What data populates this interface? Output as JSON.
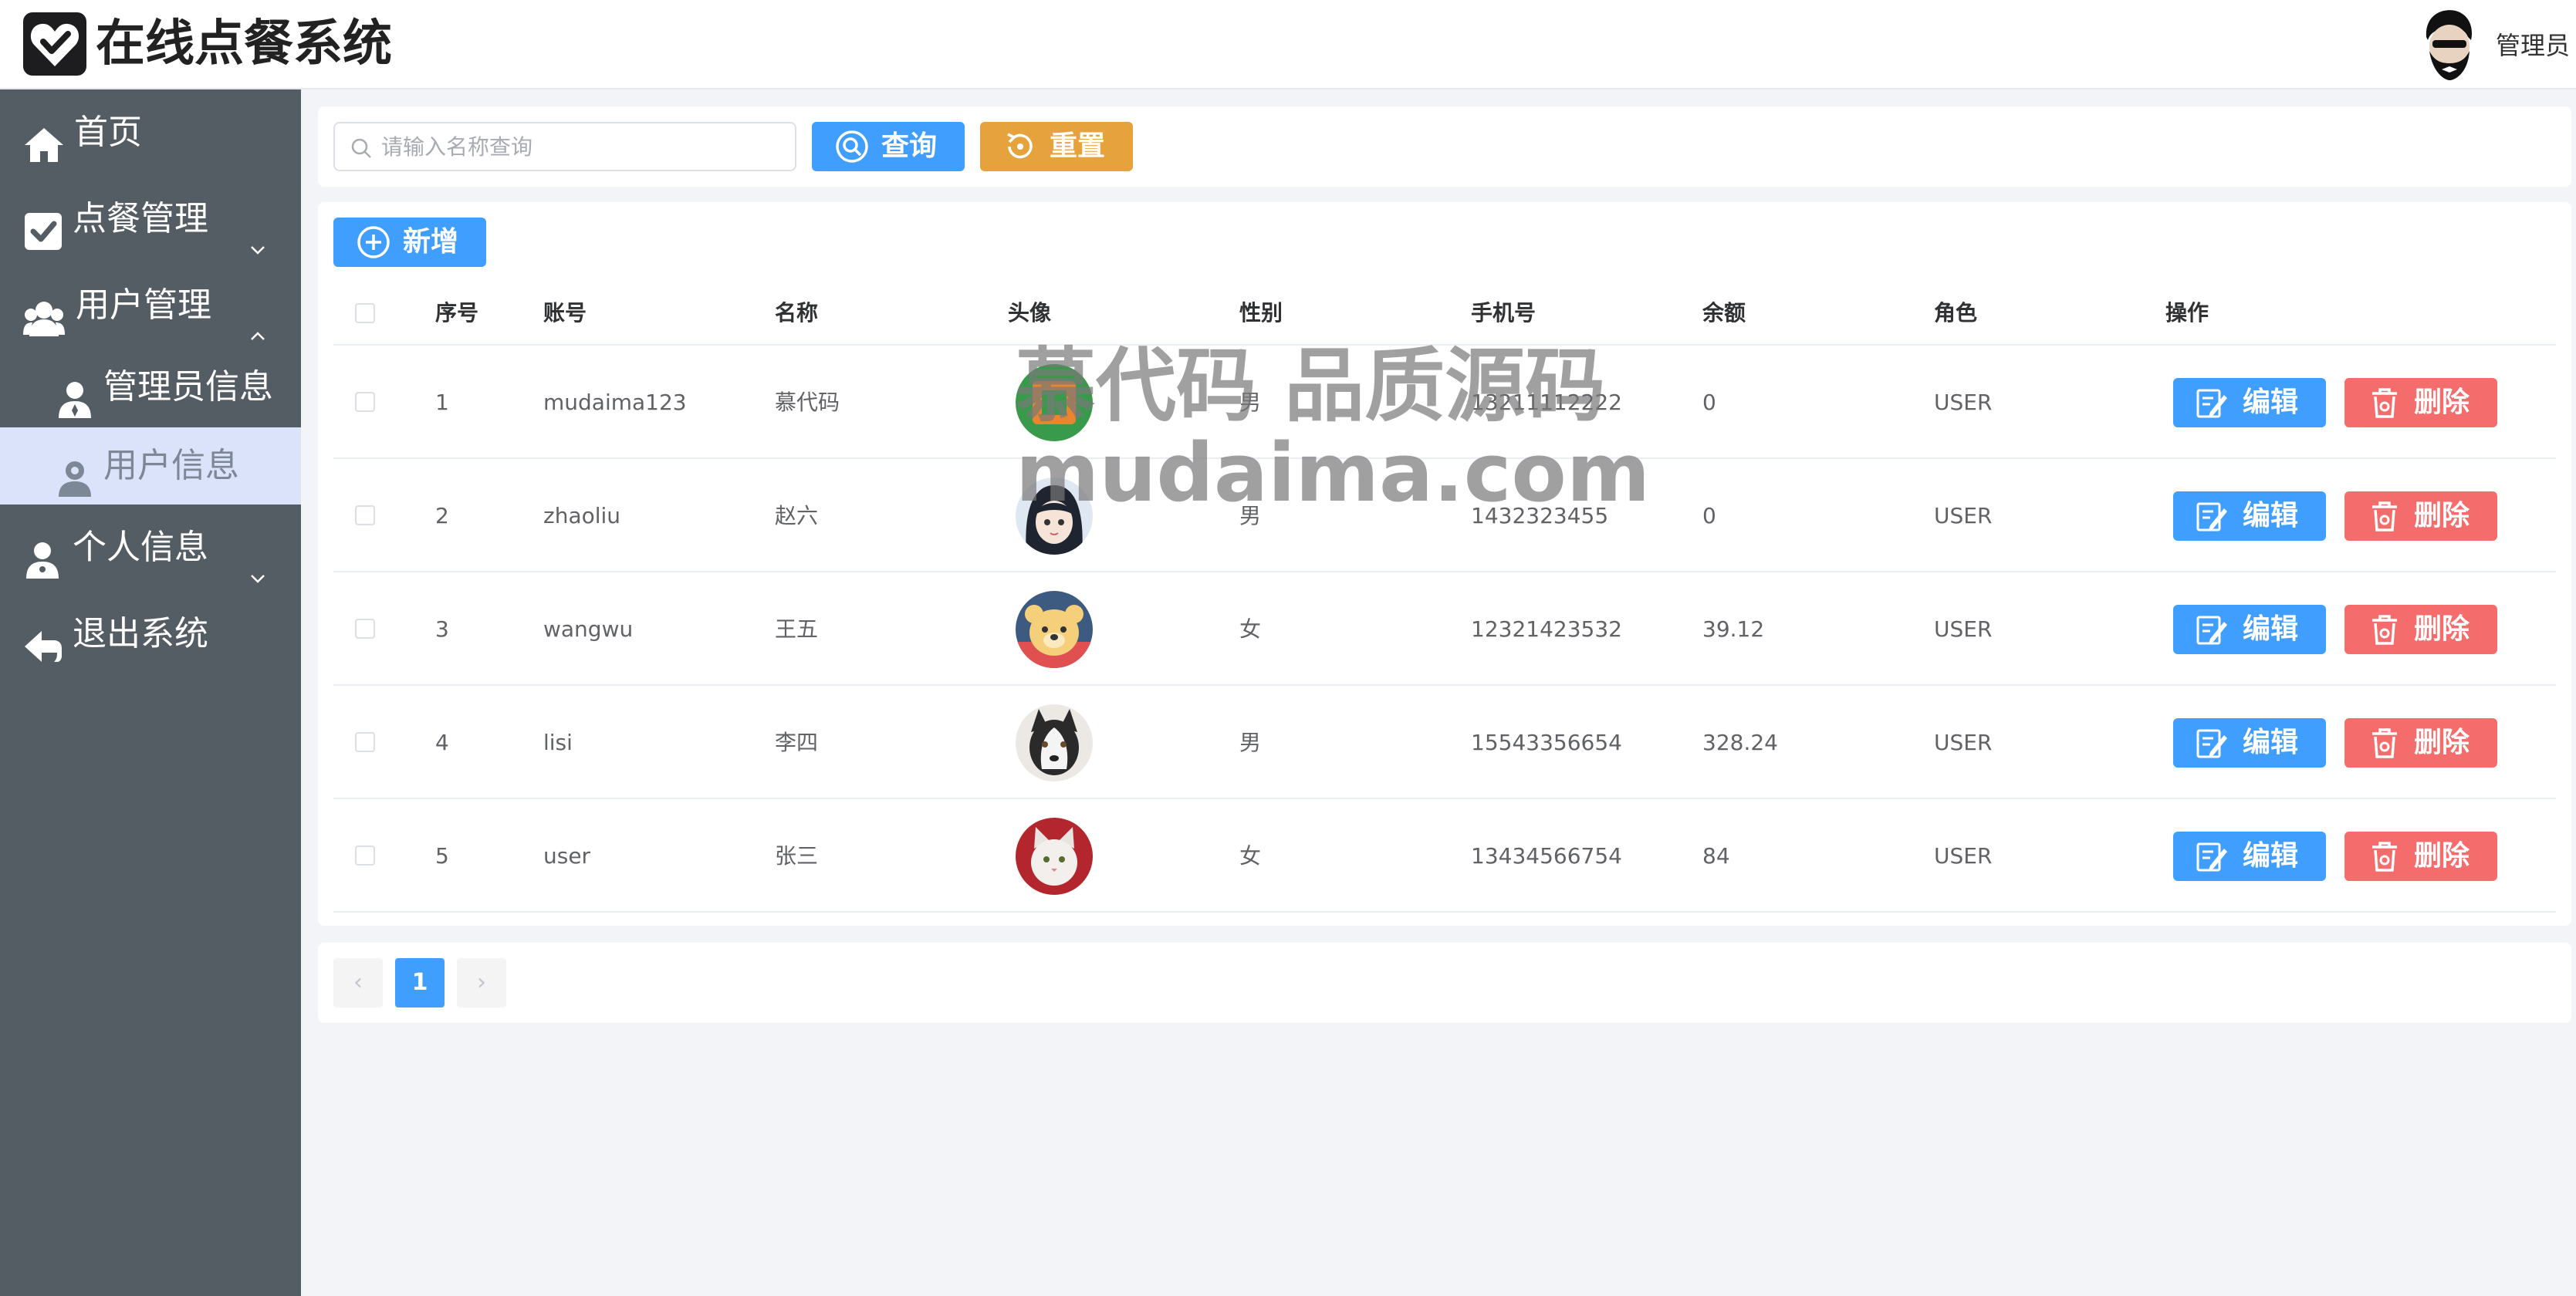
{
  "header": {
    "app_title": "在线点餐系统",
    "admin_name": "管理员",
    "logo_icon": "heart-check-icon"
  },
  "sidebar": {
    "items": [
      {
        "label": "首页",
        "icon": "home-icon"
      },
      {
        "label": "点餐管理",
        "icon": "check-square-icon",
        "arrow": "chevron-down"
      },
      {
        "label": "用户管理",
        "icon": "users-icon",
        "arrow": "chevron-up"
      },
      {
        "label": "管理员信息",
        "icon": "admin-user-icon"
      },
      {
        "label": "用户信息",
        "icon": "user-pin-icon",
        "active": true
      },
      {
        "label": "个人信息",
        "icon": "person-icon",
        "arrow": "chevron-down"
      },
      {
        "label": "退出系统",
        "icon": "logout-icon"
      }
    ]
  },
  "search": {
    "placeholder": "请输入名称查询",
    "query_label": "查询",
    "reset_label": "重置"
  },
  "toolbar": {
    "add_label": "新增"
  },
  "table": {
    "columns": [
      "序号",
      "账号",
      "名称",
      "头像",
      "性别",
      "手机号",
      "余额",
      "角色",
      "操作"
    ],
    "rows": [
      {
        "id": "1",
        "account": "mudaima123",
        "name": "慕代码",
        "avatar": "green-square-avatar",
        "gender": "男",
        "phone": "13211112222",
        "balance": "0",
        "role": "USER"
      },
      {
        "id": "2",
        "account": "zhaoliu",
        "name": "赵六",
        "avatar": "anime-girl-avatar",
        "gender": "男",
        "phone": "1432323455",
        "balance": "0",
        "role": "USER"
      },
      {
        "id": "3",
        "account": "wangwu",
        "name": "王五",
        "avatar": "bear-avatar",
        "gender": "女",
        "phone": "12321423532",
        "balance": "39.12",
        "role": "USER"
      },
      {
        "id": "4",
        "account": "lisi",
        "name": "李四",
        "avatar": "husky-avatar",
        "gender": "男",
        "phone": "15543356654",
        "balance": "328.24",
        "role": "USER"
      },
      {
        "id": "5",
        "account": "user",
        "name": "张三",
        "avatar": "cat-avatar",
        "gender": "女",
        "phone": "13434566754",
        "balance": "84",
        "role": "USER"
      }
    ],
    "edit_label": "编辑",
    "delete_label": "删除"
  },
  "pagination": {
    "current_page": "1",
    "prev": "‹",
    "next": "›"
  },
  "watermark": {
    "line1": "慕代码 品质源码",
    "line2": "mudaima.com"
  },
  "colors": {
    "sidebar_bg": "#545c64",
    "primary": "#409eff",
    "warning": "#e6a23c",
    "danger": "#f56c6c",
    "active_menu_bg": "#dbe3fa"
  }
}
